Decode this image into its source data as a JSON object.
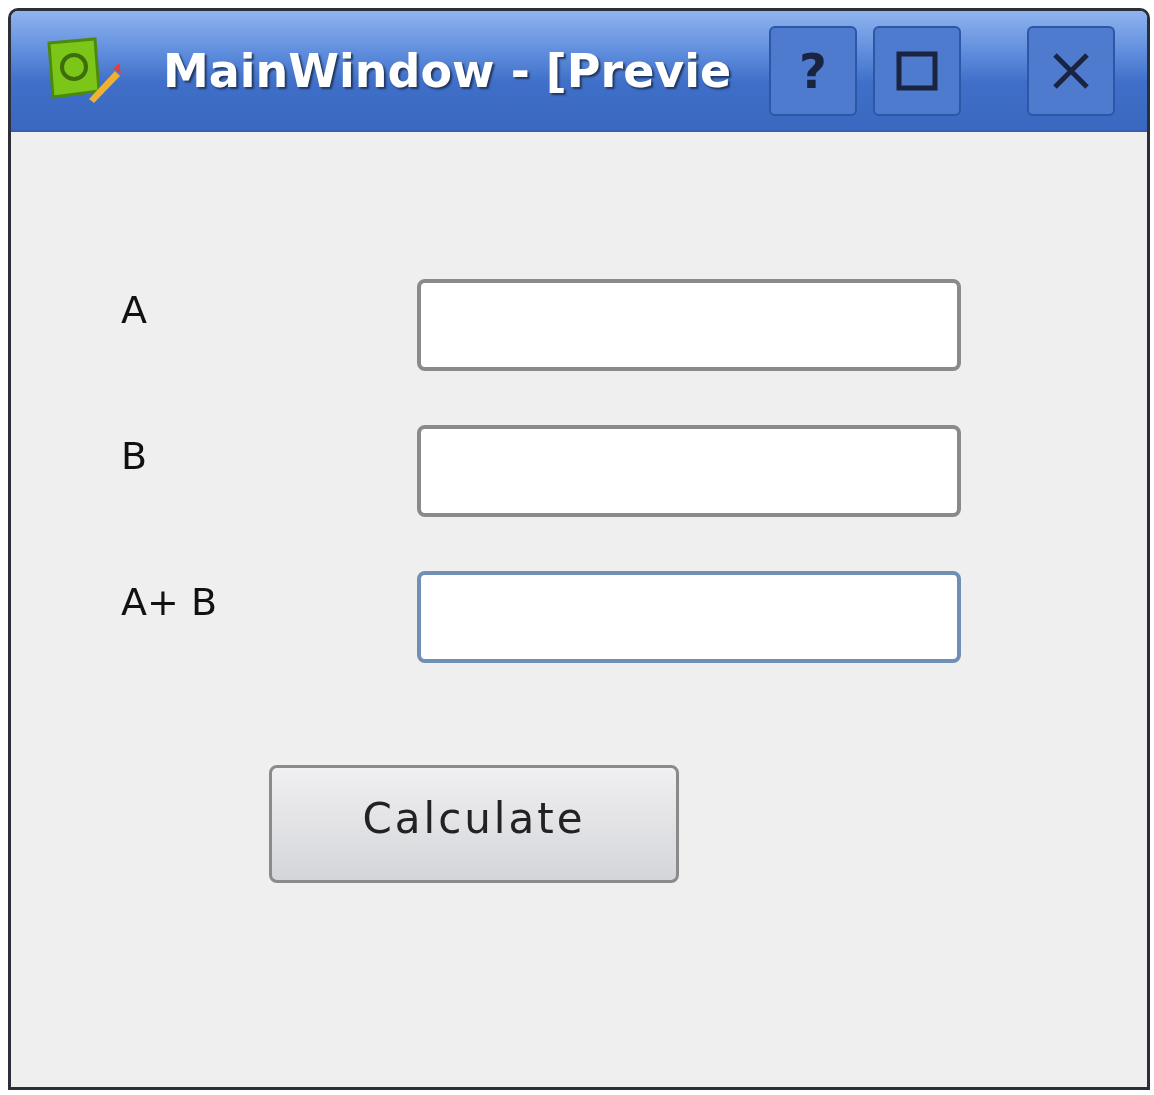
{
  "window": {
    "title": "MainWindow - [Previe",
    "help_button": "?"
  },
  "fields": [
    {
      "label": "A",
      "focused": false
    },
    {
      "label": "B",
      "focused": false
    },
    {
      "label": "A+ B",
      "focused": true
    }
  ],
  "button": {
    "label": "Calculate"
  }
}
